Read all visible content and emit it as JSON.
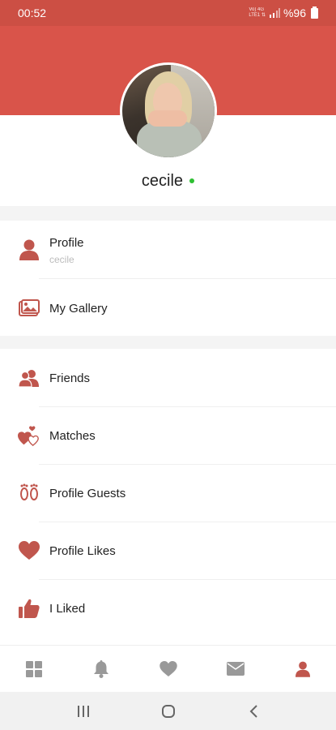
{
  "status": {
    "time": "00:52",
    "net_top": "Vo) 4G",
    "net_bottom": "LTE1 ⇅",
    "battery": "%96"
  },
  "profile": {
    "name": "cecile"
  },
  "colors": {
    "accent": "#d9544a",
    "icon": "#c0564d",
    "online": "#2ec033"
  },
  "menu_section1": [
    {
      "label": "Profile",
      "sub": "cecile",
      "icon": "person-icon"
    },
    {
      "label": "My Gallery",
      "icon": "gallery-icon"
    }
  ],
  "menu_section2": [
    {
      "label": "Friends",
      "icon": "friends-icon"
    },
    {
      "label": "Matches",
      "icon": "matches-icon"
    },
    {
      "label": "Profile Guests",
      "icon": "footprints-icon"
    },
    {
      "label": "Profile Likes",
      "icon": "heart-icon"
    },
    {
      "label": "I Liked",
      "icon": "thumbs-up-icon"
    }
  ],
  "bottom_nav": [
    "grid-icon",
    "bell-icon",
    "heart-icon",
    "mail-icon",
    "person-icon"
  ],
  "system_nav": [
    "recents-icon",
    "home-icon",
    "back-icon"
  ]
}
